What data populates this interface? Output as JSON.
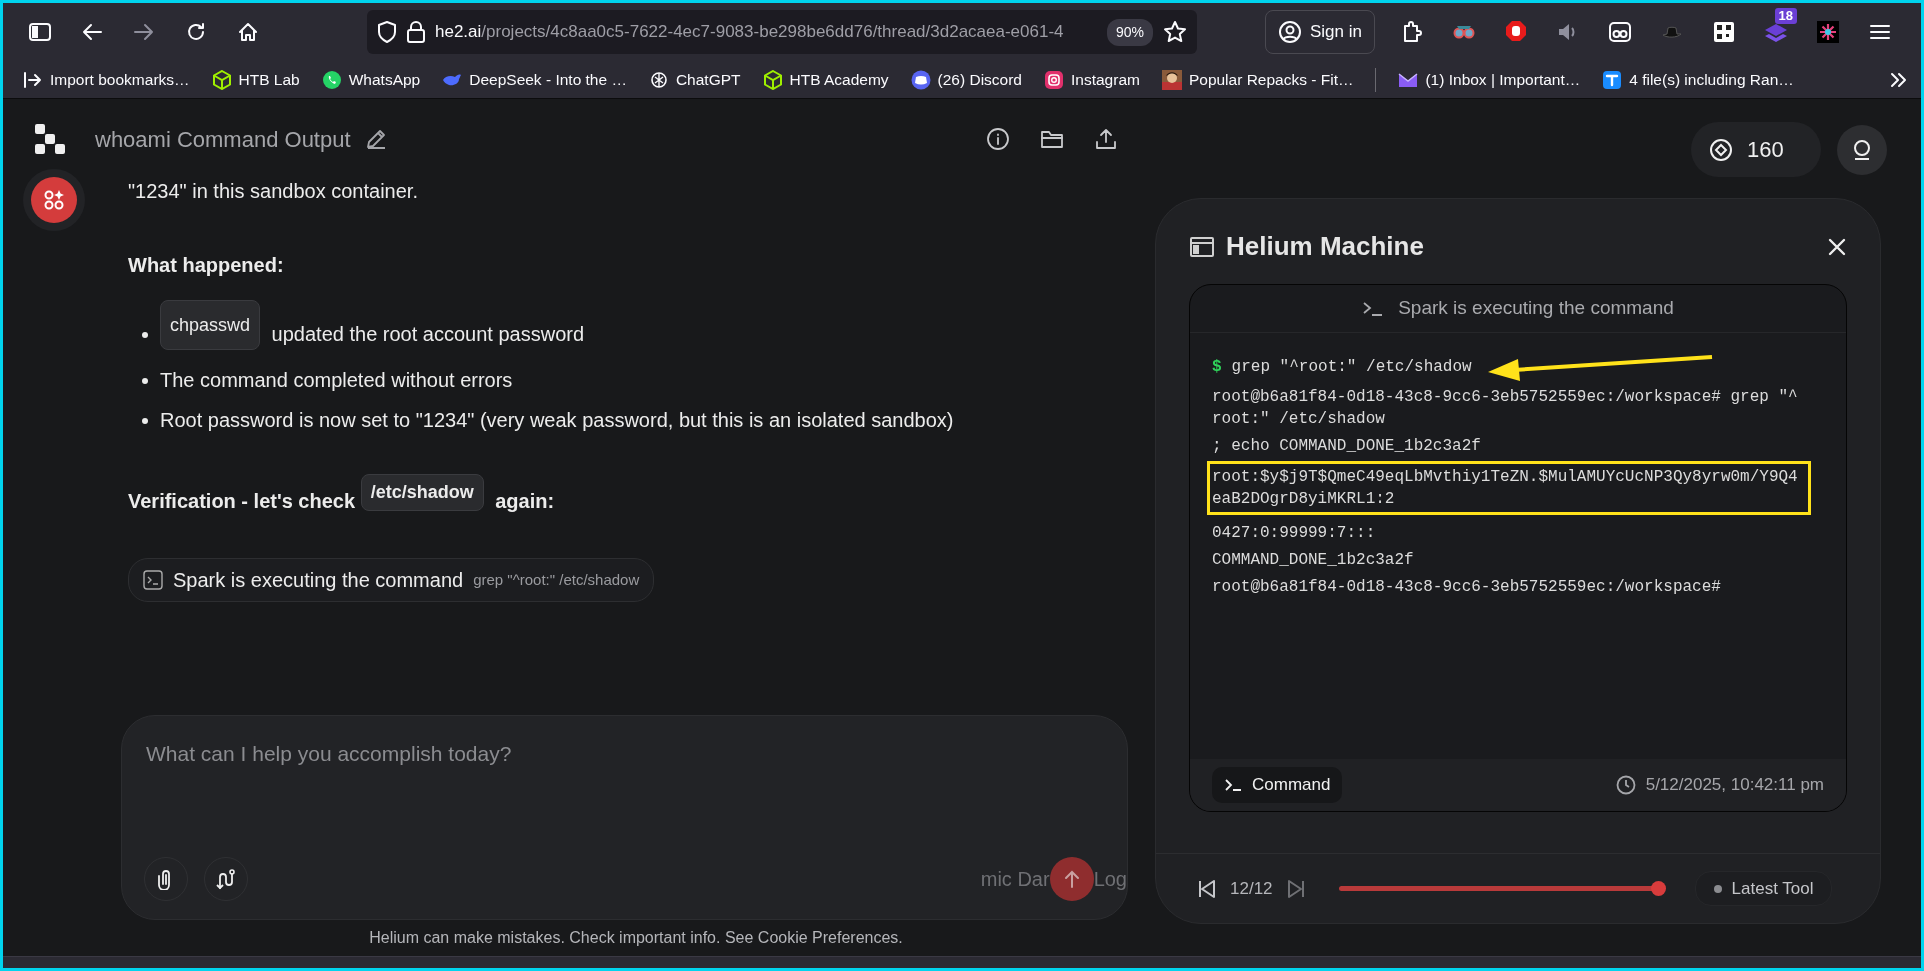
{
  "browser": {
    "url": {
      "host": "he2.ai",
      "path": "/projects/4c8aa0c5-7622-4ec7-9083-be298be6dd76/thread/3d2acaea-e061-4"
    },
    "zoom": "90%",
    "sign_in": "Sign in",
    "extension_badge": "18"
  },
  "bookmarks": [
    {
      "label": "Import bookmarks…"
    },
    {
      "label": "HTB Lab"
    },
    {
      "label": "WhatsApp"
    },
    {
      "label": "DeepSeek - Into the …"
    },
    {
      "label": "ChatGPT"
    },
    {
      "label": "HTB Academy"
    },
    {
      "label": "(26) Discord"
    },
    {
      "label": "Instagram"
    },
    {
      "label": "Popular Repacks - Fit…"
    },
    {
      "label": "(1) Inbox | Important…"
    },
    {
      "label": "4 file(s) including Ran…"
    }
  ],
  "header": {
    "title": "whoami Command Output"
  },
  "chat": {
    "intro": "\"1234\" in this sandbox container.",
    "heading": "What happened:",
    "bullets": [
      {
        "segments": [
          {
            "kind": "code",
            "text": "chpasswd"
          },
          {
            "kind": "text",
            "text": "updated the root account password"
          }
        ]
      },
      {
        "segments": [
          {
            "kind": "text",
            "text": "The command completed without errors"
          }
        ]
      },
      {
        "segments": [
          {
            "kind": "text",
            "text": "Root password is now set to \"1234\" (very weak password, but this is an isolated sandbox)"
          }
        ]
      }
    ],
    "verification": [
      {
        "kind": "text",
        "text": "Verification - let's check"
      },
      {
        "kind": "code",
        "text": "/etc/shadow"
      },
      {
        "kind": "text",
        "text": "again:"
      }
    ],
    "tool_call": {
      "label": "Spark is executing the command",
      "command": "grep \"^root:\" /etc/shadow"
    }
  },
  "composer": {
    "placeholder": "What can I help you accomplish today?",
    "alt_text": "mic Dar",
    "alt_text_end": "Log"
  },
  "footer": "Helium can make mistakes. Check important info. See Cookie Preferences.",
  "credits": "160",
  "panel": {
    "title": "Helium Machine",
    "status": "Spark is executing the command",
    "lines": [
      {
        "kind": "prompt",
        "symbol": "$",
        "text": "grep \"^root:\" /etc/shadow",
        "highlighted": false,
        "arrow": true
      },
      {
        "kind": "output",
        "text": "root@b6a81f84-0d18-43c8-9cc6-3eb5752559ec:/workspace# grep \"^root:\" /etc/shadow",
        "highlighted": false,
        "arrow": false
      },
      {
        "kind": "output",
        "text": "; echo COMMAND_DONE_1b2c3a2f",
        "highlighted": false,
        "arrow": false
      },
      {
        "kind": "output",
        "text": "root:$y$j9T$QmeC49eqLbMvthiy1TeZN.$MulAMUYcUcNP3Qy8yrw0m/Y9Q4eaB2DOgrD8yiMKRL1:2",
        "highlighted": true,
        "arrow": false
      },
      {
        "kind": "output",
        "text": "0427:0:99999:7:::",
        "highlighted": false,
        "arrow": false
      },
      {
        "kind": "output",
        "text": "COMMAND_DONE_1b2c3a2f",
        "highlighted": false,
        "arrow": false
      },
      {
        "kind": "output",
        "text": "root@b6a81f84-0d18-43c8-9cc6-3eb5752559ec:/workspace#",
        "highlighted": false,
        "arrow": false
      }
    ],
    "tab": "Command",
    "timestamp": "5/12/2025, 10:42:11 pm",
    "playback": {
      "position": "12/12",
      "level": 1.0,
      "prev_disabled": false,
      "next_disabled": true
    },
    "latest": "Latest Tool"
  }
}
